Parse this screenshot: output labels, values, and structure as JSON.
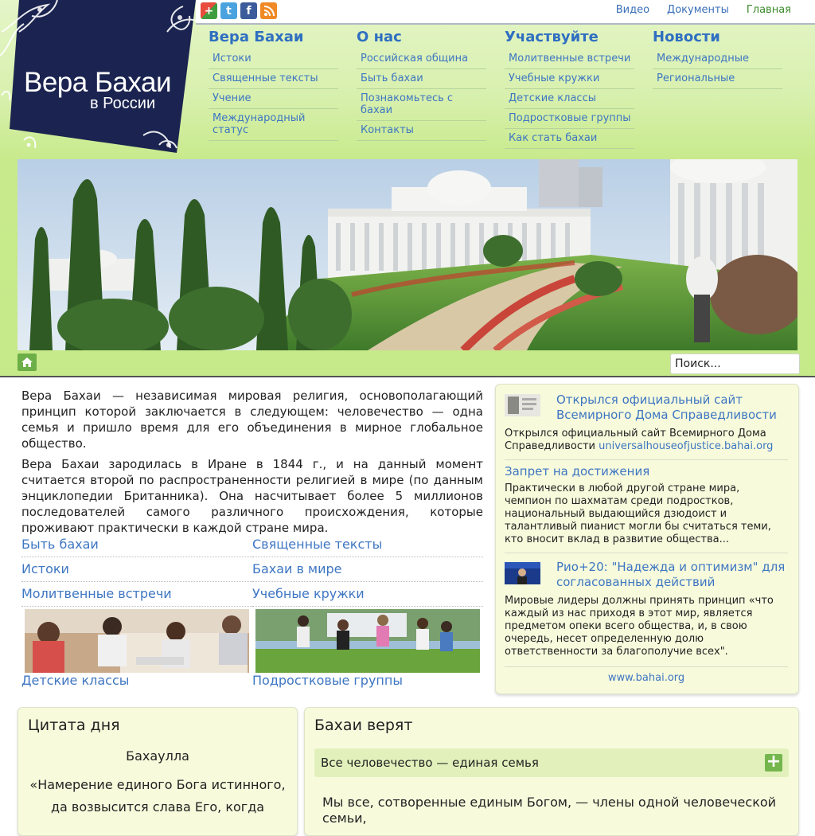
{
  "site": {
    "logo_title": "Вера Бахаи",
    "logo_subtitle": "в России"
  },
  "social_icons": [
    "google-plus-icon",
    "twitter-icon",
    "facebook-icon",
    "rss-icon"
  ],
  "top_links": [
    "Видео",
    "Документы",
    "Главная"
  ],
  "menus": [
    {
      "title": "Вера Бахаи",
      "items": [
        "Истоки",
        "Священные тексты",
        "Учение",
        "Международный статус"
      ]
    },
    {
      "title": "О нас",
      "items": [
        "Российская община",
        "Быть бахаи",
        "Познакомьтесь с бахаи",
        "Контакты"
      ]
    },
    {
      "title": "Участвуйте",
      "items": [
        "Молитвенные встречи",
        "Учебные кружки",
        "Детские классы",
        "Подростковые группы",
        "Как стать бахаи"
      ]
    },
    {
      "title": "Новости",
      "items": [
        "Международные",
        "Региональные"
      ]
    }
  ],
  "search": {
    "placeholder": "Поиск..."
  },
  "intro": {
    "p1": "Вера Бахаи — независимая мировая религия, основополагающий принцип которой заключается в следующем: человечество — одна семья и пришло время для его объединения в мирное глобальное общество.",
    "p2": "Вера Бахаи зародилась в Иране в 1844 г., и на данный момент считается второй по распространенности религией в мире (по данным энциклопедии Британника). Она насчитывает более 5 миллионов последователей самого различного происхождения, которые проживают практически в каждой стране мира."
  },
  "quick_links": [
    "Быть бахаи",
    "Священные тексты",
    "Истоки",
    "Бахаи в мире",
    "Молитвенные встречи",
    "Учебные кружки"
  ],
  "photo_captions": [
    "Детские классы",
    "Подростковые группы"
  ],
  "news": [
    {
      "title": "Открылся официальный сайт Всемирного Дома Справедливости",
      "text": "Открылся официальный сайт Всемирного Дома Справедливости ",
      "link": "universalhouseofjustice.bahai.org"
    },
    {
      "title": "Запрет на достижения",
      "text": "Практически в любой другой стране мира, чемпион по шахматам среди подростков, национальный выдающийся дзюдоист и талантливый пианист могли бы считаться теми, кто вносит вклад в развитие общества..."
    },
    {
      "title": "Рио+20: \"Надежда и оптимизм\" для согласованных действий",
      "text": "Мировые лидеры должны принять принцип «что каждый из нас приходя в этот мир, является предметом опеки всего общества, и, в свою очередь, несет определенную долю ответственности за благополучие всех\"."
    }
  ],
  "news_footer_link": "www.bahai.org",
  "quote": {
    "heading": "Цитата дня",
    "author": "Бахаулла",
    "text": "«Намерение единого Бога истинного, да возвысится слава Его, когда"
  },
  "beliefs": {
    "heading": "Бахаи верят",
    "item": "Все человечество — единая семья",
    "text": "Мы все, сотворенные единым Богом, — члены одной человеческой семьи,"
  }
}
